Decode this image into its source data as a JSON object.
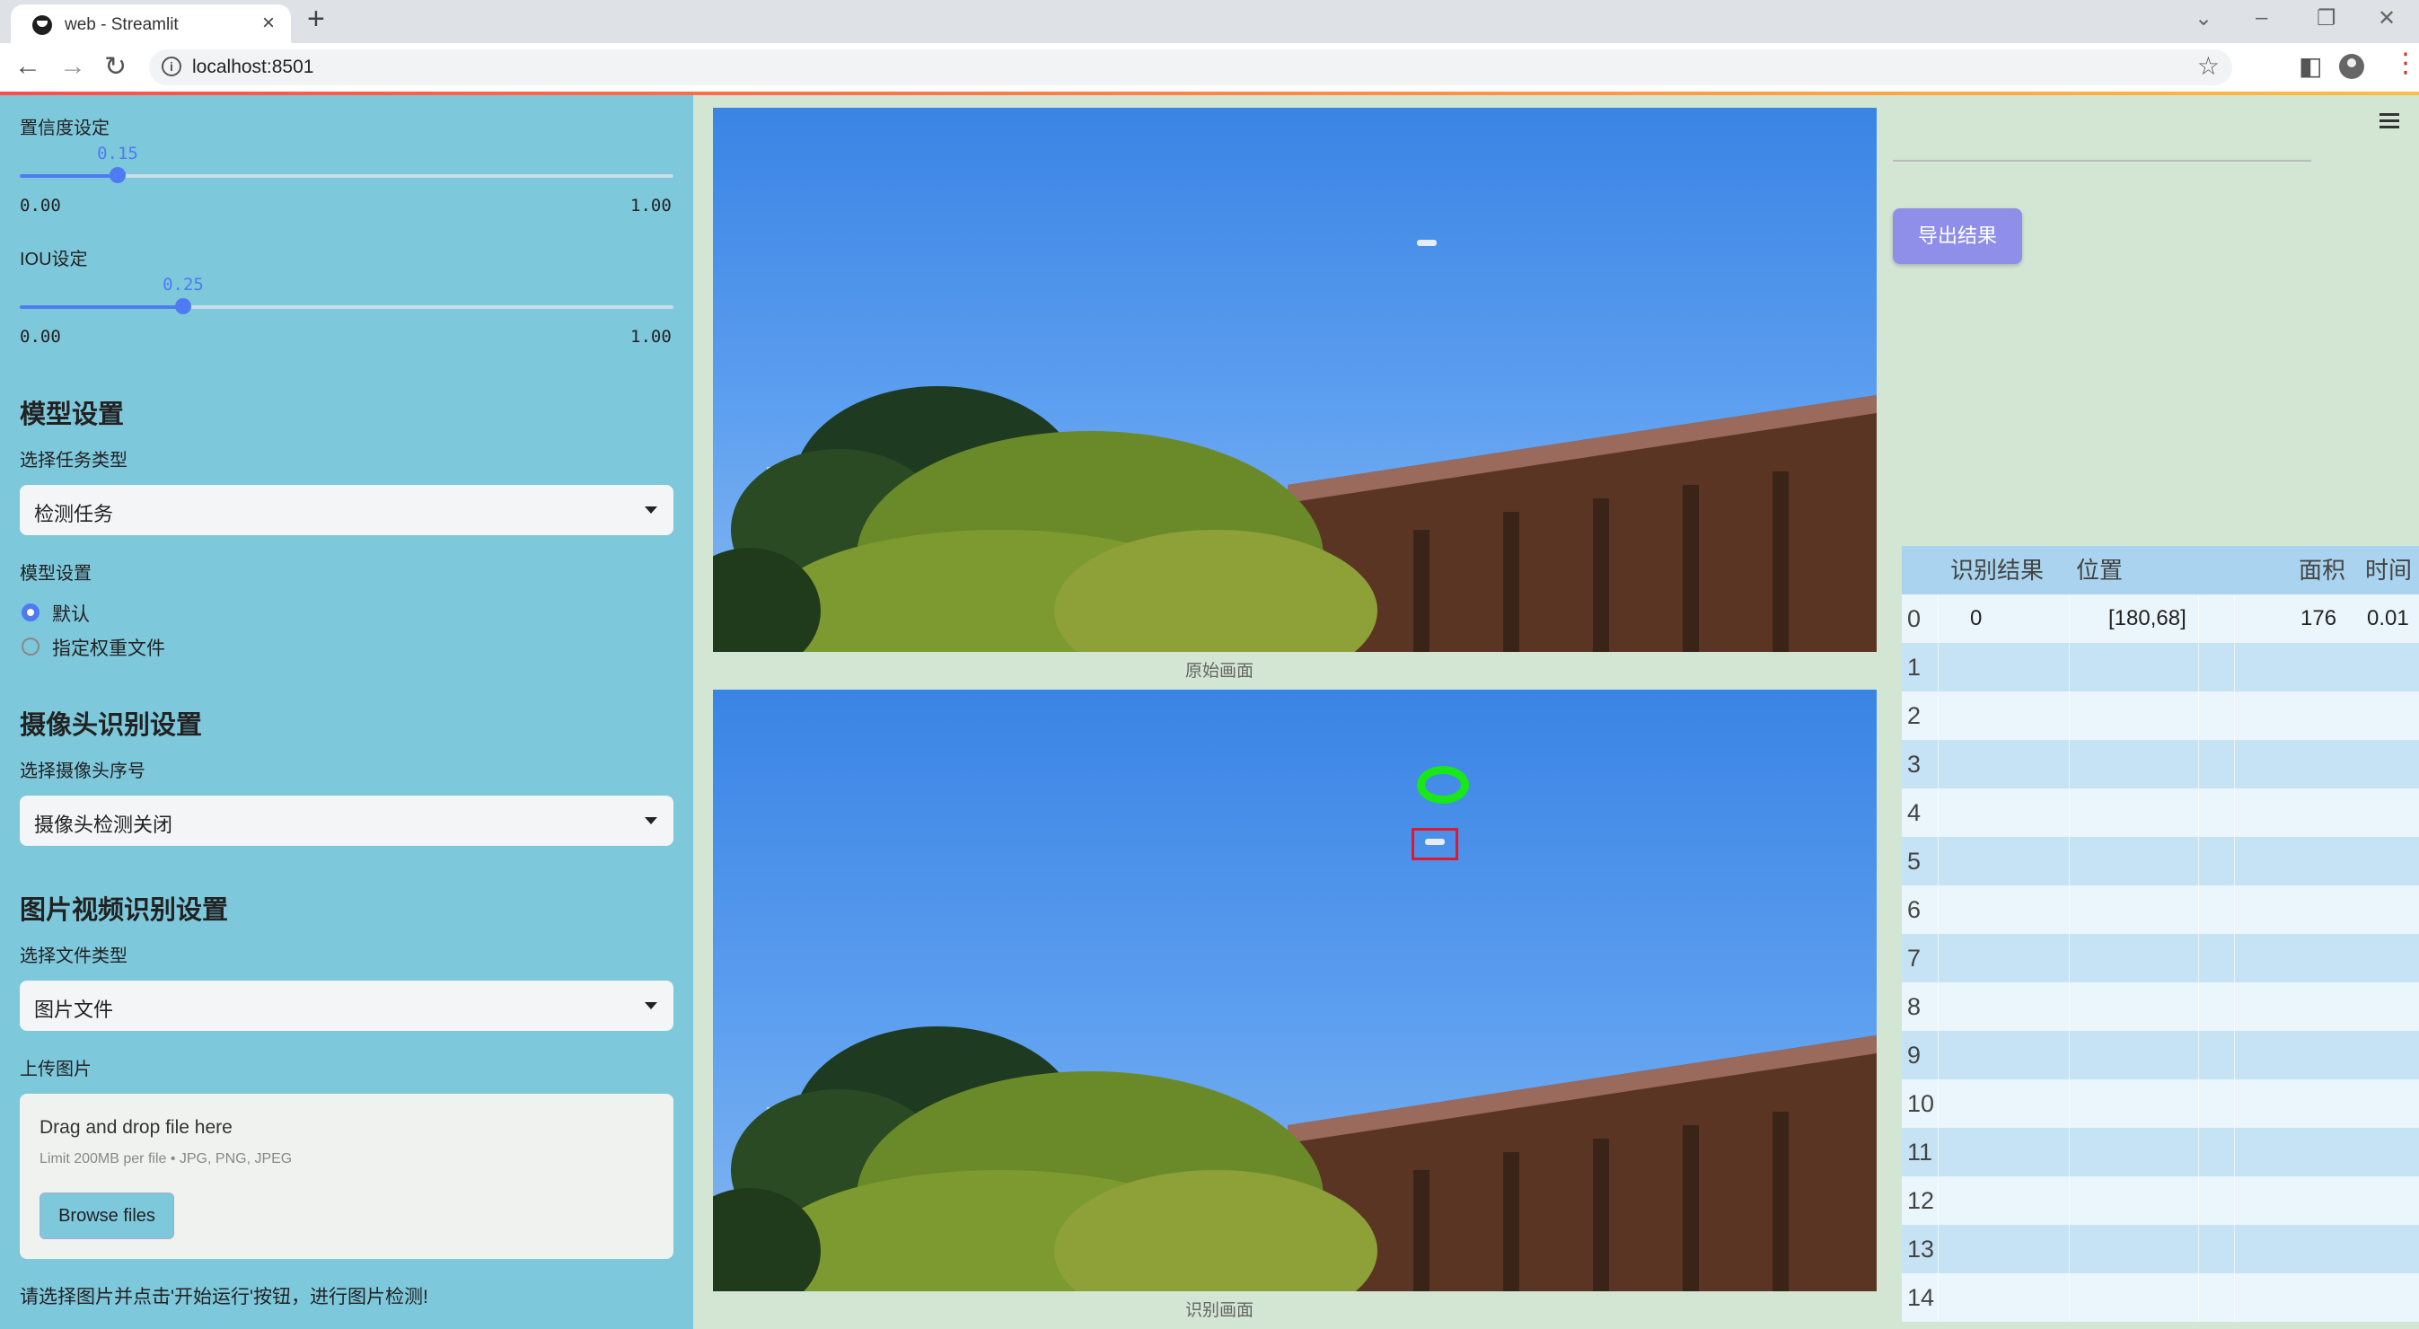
{
  "browser": {
    "tab_title": "web - Streamlit",
    "url": "localhost:8501"
  },
  "sidebar": {
    "confidence": {
      "label": "置信度设定",
      "value": "0.15",
      "value_num": 0.15,
      "min": "0.00",
      "max": "1.00"
    },
    "iou": {
      "label": "IOU设定",
      "value": "0.25",
      "value_num": 0.25,
      "min": "0.00",
      "max": "1.00"
    },
    "model_section": {
      "title": "模型设置",
      "task_label": "选择任务类型",
      "task_value": "检测任务",
      "model_label": "模型设置",
      "options": [
        "默认",
        "指定权重文件"
      ],
      "selected": 0
    },
    "camera_section": {
      "title": "摄像头识别设置",
      "label": "选择摄像头序号",
      "value": "摄像头检测关闭"
    },
    "media_section": {
      "title": "图片视频识别设置",
      "file_type_label": "选择文件类型",
      "file_type_value": "图片文件",
      "upload_label": "上传图片",
      "drop_title": "Drag and drop file here",
      "drop_limit": "Limit 200MB per file • JPG, PNG, JPEG",
      "browse_label": "Browse files"
    },
    "hint": "请选择图片并点击'开始运行'按钮，进行图片检测!"
  },
  "main": {
    "original_caption": "原始画面",
    "result_caption": "识别画面"
  },
  "right": {
    "export_label": "导出结果",
    "table": {
      "headers": [
        "",
        "识别结果",
        "位置",
        "面积",
        "时间"
      ],
      "rows": [
        [
          "0",
          "0",
          "[180,68]",
          "176",
          "0.01"
        ],
        [
          "1",
          "",
          "",
          "",
          ""
        ],
        [
          "2",
          "",
          "",
          "",
          ""
        ],
        [
          "3",
          "",
          "",
          "",
          ""
        ],
        [
          "4",
          "",
          "",
          "",
          ""
        ],
        [
          "5",
          "",
          "",
          "",
          ""
        ],
        [
          "6",
          "",
          "",
          "",
          ""
        ],
        [
          "7",
          "",
          "",
          "",
          ""
        ],
        [
          "8",
          "",
          "",
          "",
          ""
        ],
        [
          "9",
          "",
          "",
          "",
          ""
        ],
        [
          "10",
          "",
          "",
          "",
          ""
        ],
        [
          "11",
          "",
          "",
          "",
          ""
        ],
        [
          "12",
          "",
          "",
          "",
          ""
        ],
        [
          "13",
          "",
          "",
          "",
          ""
        ],
        [
          "14",
          "",
          "",
          "",
          ""
        ]
      ]
    }
  },
  "colors": {
    "sidebar_bg": "#7ec8dc",
    "accent": "#4e7bf2",
    "export_button": "#8f8ee8",
    "detection_ring": "#18e818",
    "detection_box": "#e0182a"
  },
  "icons": [
    "streamlit-favicon",
    "back-arrow-icon",
    "forward-arrow-icon",
    "reload-icon",
    "info-icon",
    "star-icon",
    "side-panel-icon",
    "profile-icon",
    "more-vert-icon",
    "hamburger-menu-icon",
    "dropdown-caret-icon"
  ]
}
